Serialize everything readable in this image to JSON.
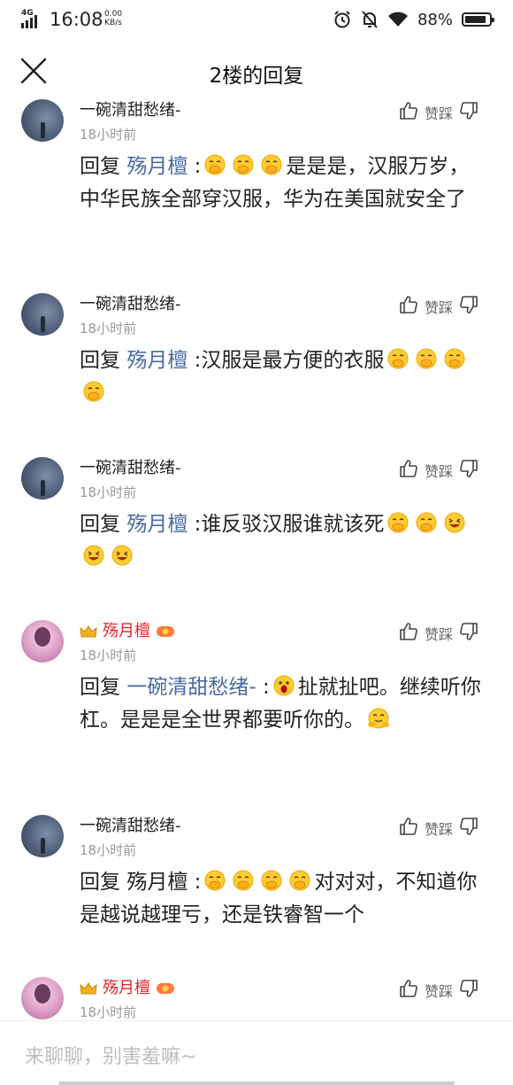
{
  "status_bar": {
    "network": "4G",
    "time": "16:08",
    "speed_value": "0.00",
    "speed_unit": "KB/s",
    "battery_percent": "88%",
    "battery_level": 0.88
  },
  "header": {
    "title": "2楼的回复"
  },
  "labels": {
    "vote": "赞踩",
    "reply": "回复"
  },
  "comments": [
    {
      "author": "一碗清甜愁绪-",
      "time": "18小时前",
      "prefix": "回复",
      "mention": "殇月檀",
      "sep": ":",
      "emojis_before": [
        "hand-over-mouth",
        "hand-over-mouth",
        "hand-over-mouth"
      ],
      "text": "是是是，汉服万岁，中华民族全部穿汉服，华为在美国就安全了",
      "emojis_after": []
    },
    {
      "author": "一碗清甜愁绪-",
      "time": "18小时前",
      "prefix": "回复",
      "mention": "殇月檀",
      "sep": ":",
      "emojis_before": [],
      "text": "汉服是最方便的衣服",
      "emojis_after": [
        "hand-over-mouth",
        "hand-over-mouth",
        "hand-over-mouth",
        "hand-over-mouth"
      ]
    },
    {
      "author": "一碗清甜愁绪-",
      "time": "18小时前",
      "prefix": "回复",
      "mention": "殇月檀",
      "sep": ":",
      "emojis_before": [],
      "text": "谁反驳汉服谁就该死",
      "emojis_after": [
        "hand-over-mouth",
        "hand-over-mouth",
        "laughing",
        "laughing",
        "laughing"
      ]
    },
    {
      "author": "殇月檀",
      "time": "18小时前",
      "prefix": "回复",
      "mention": "一碗清甜愁绪-",
      "sep": ":",
      "emojis_before": [
        "screaming"
      ],
      "text": "扯就扯吧。继续听你杠。是是是全世界都要听你的。",
      "emojis_after": [
        "hugging"
      ]
    },
    {
      "author": "一碗清甜愁绪-",
      "time": "18小时前",
      "prefix": "回复",
      "mention": "殇月檀",
      "sep": ":",
      "emojis_before": [
        "hand-over-mouth",
        "hand-over-mouth",
        "hand-over-mouth",
        "hand-over-mouth"
      ],
      "text": "对对对，不知道你是越说越理亏，还是铁睿智一个",
      "emojis_after": []
    },
    {
      "author": "殇月檀",
      "time": "18小时前"
    }
  ],
  "input": {
    "placeholder": "来聊聊，别害羞嘛~"
  },
  "colors": {
    "author_vip": "#e4252f",
    "mention": "#4a6aa0",
    "meta": "#999999"
  }
}
